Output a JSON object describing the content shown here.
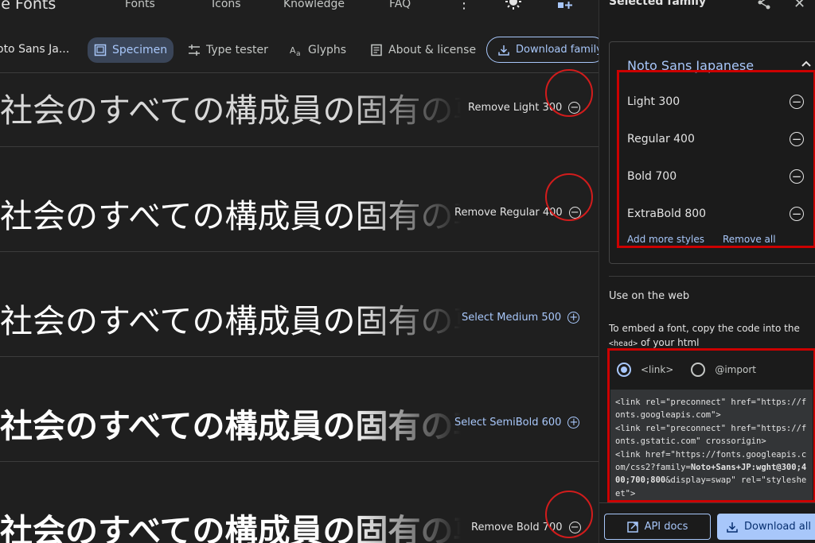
{
  "nav": {
    "brand": "le Fonts",
    "links": [
      "Fonts",
      "Icons",
      "Knowledge",
      "FAQ"
    ]
  },
  "tabs": {
    "family_short": "oto Sans Ja...",
    "items": [
      "Specimen",
      "Type tester",
      "Glyphs",
      "About & license"
    ],
    "download": "Download family"
  },
  "sample_text": "社会のすべての構成員の固有の尊厳",
  "rows": [
    {
      "action": "Remove Light 300",
      "kind": "remove"
    },
    {
      "action": "Remove Regular 400",
      "kind": "remove"
    },
    {
      "action": "Select Medium 500",
      "kind": "select"
    },
    {
      "action": "Select SemiBold 600",
      "kind": "select"
    },
    {
      "action": "Remove Bold 700",
      "kind": "remove"
    }
  ],
  "panel": {
    "title": "Selected family",
    "family": "Noto Sans Japanese",
    "styles": [
      "Light 300",
      "Regular 400",
      "Bold 700",
      "ExtraBold 800"
    ],
    "add_more": "Add more styles",
    "remove_all": "Remove all",
    "use_web": "Use on the web",
    "embed_text": "To embed a font, copy the code into the",
    "embed_code": "<head>",
    "embed_tail": "of your html",
    "radio_link": "<link>",
    "radio_import": "@import",
    "code_line1": "<link rel=\"preconnect\" href=\"https://fonts.googleapis.com\">",
    "code_line2": "<link rel=\"preconnect\" href=\"https://fonts.gstatic.com\" crossorigin>",
    "code_line3a": "<link href=\"https://fonts.googleapis.com/css2?family=",
    "code_line3b": "Noto+Sans+JP:wght@300;400;700;800",
    "code_line3c": "&display=swap\" rel=\"stylesheet\">",
    "api_docs": "API docs",
    "download_all": "Download all"
  },
  "colors": {
    "accent": "#a8c7fa",
    "annotation_red": "#d21c1c",
    "background": "#1f1f1f"
  }
}
